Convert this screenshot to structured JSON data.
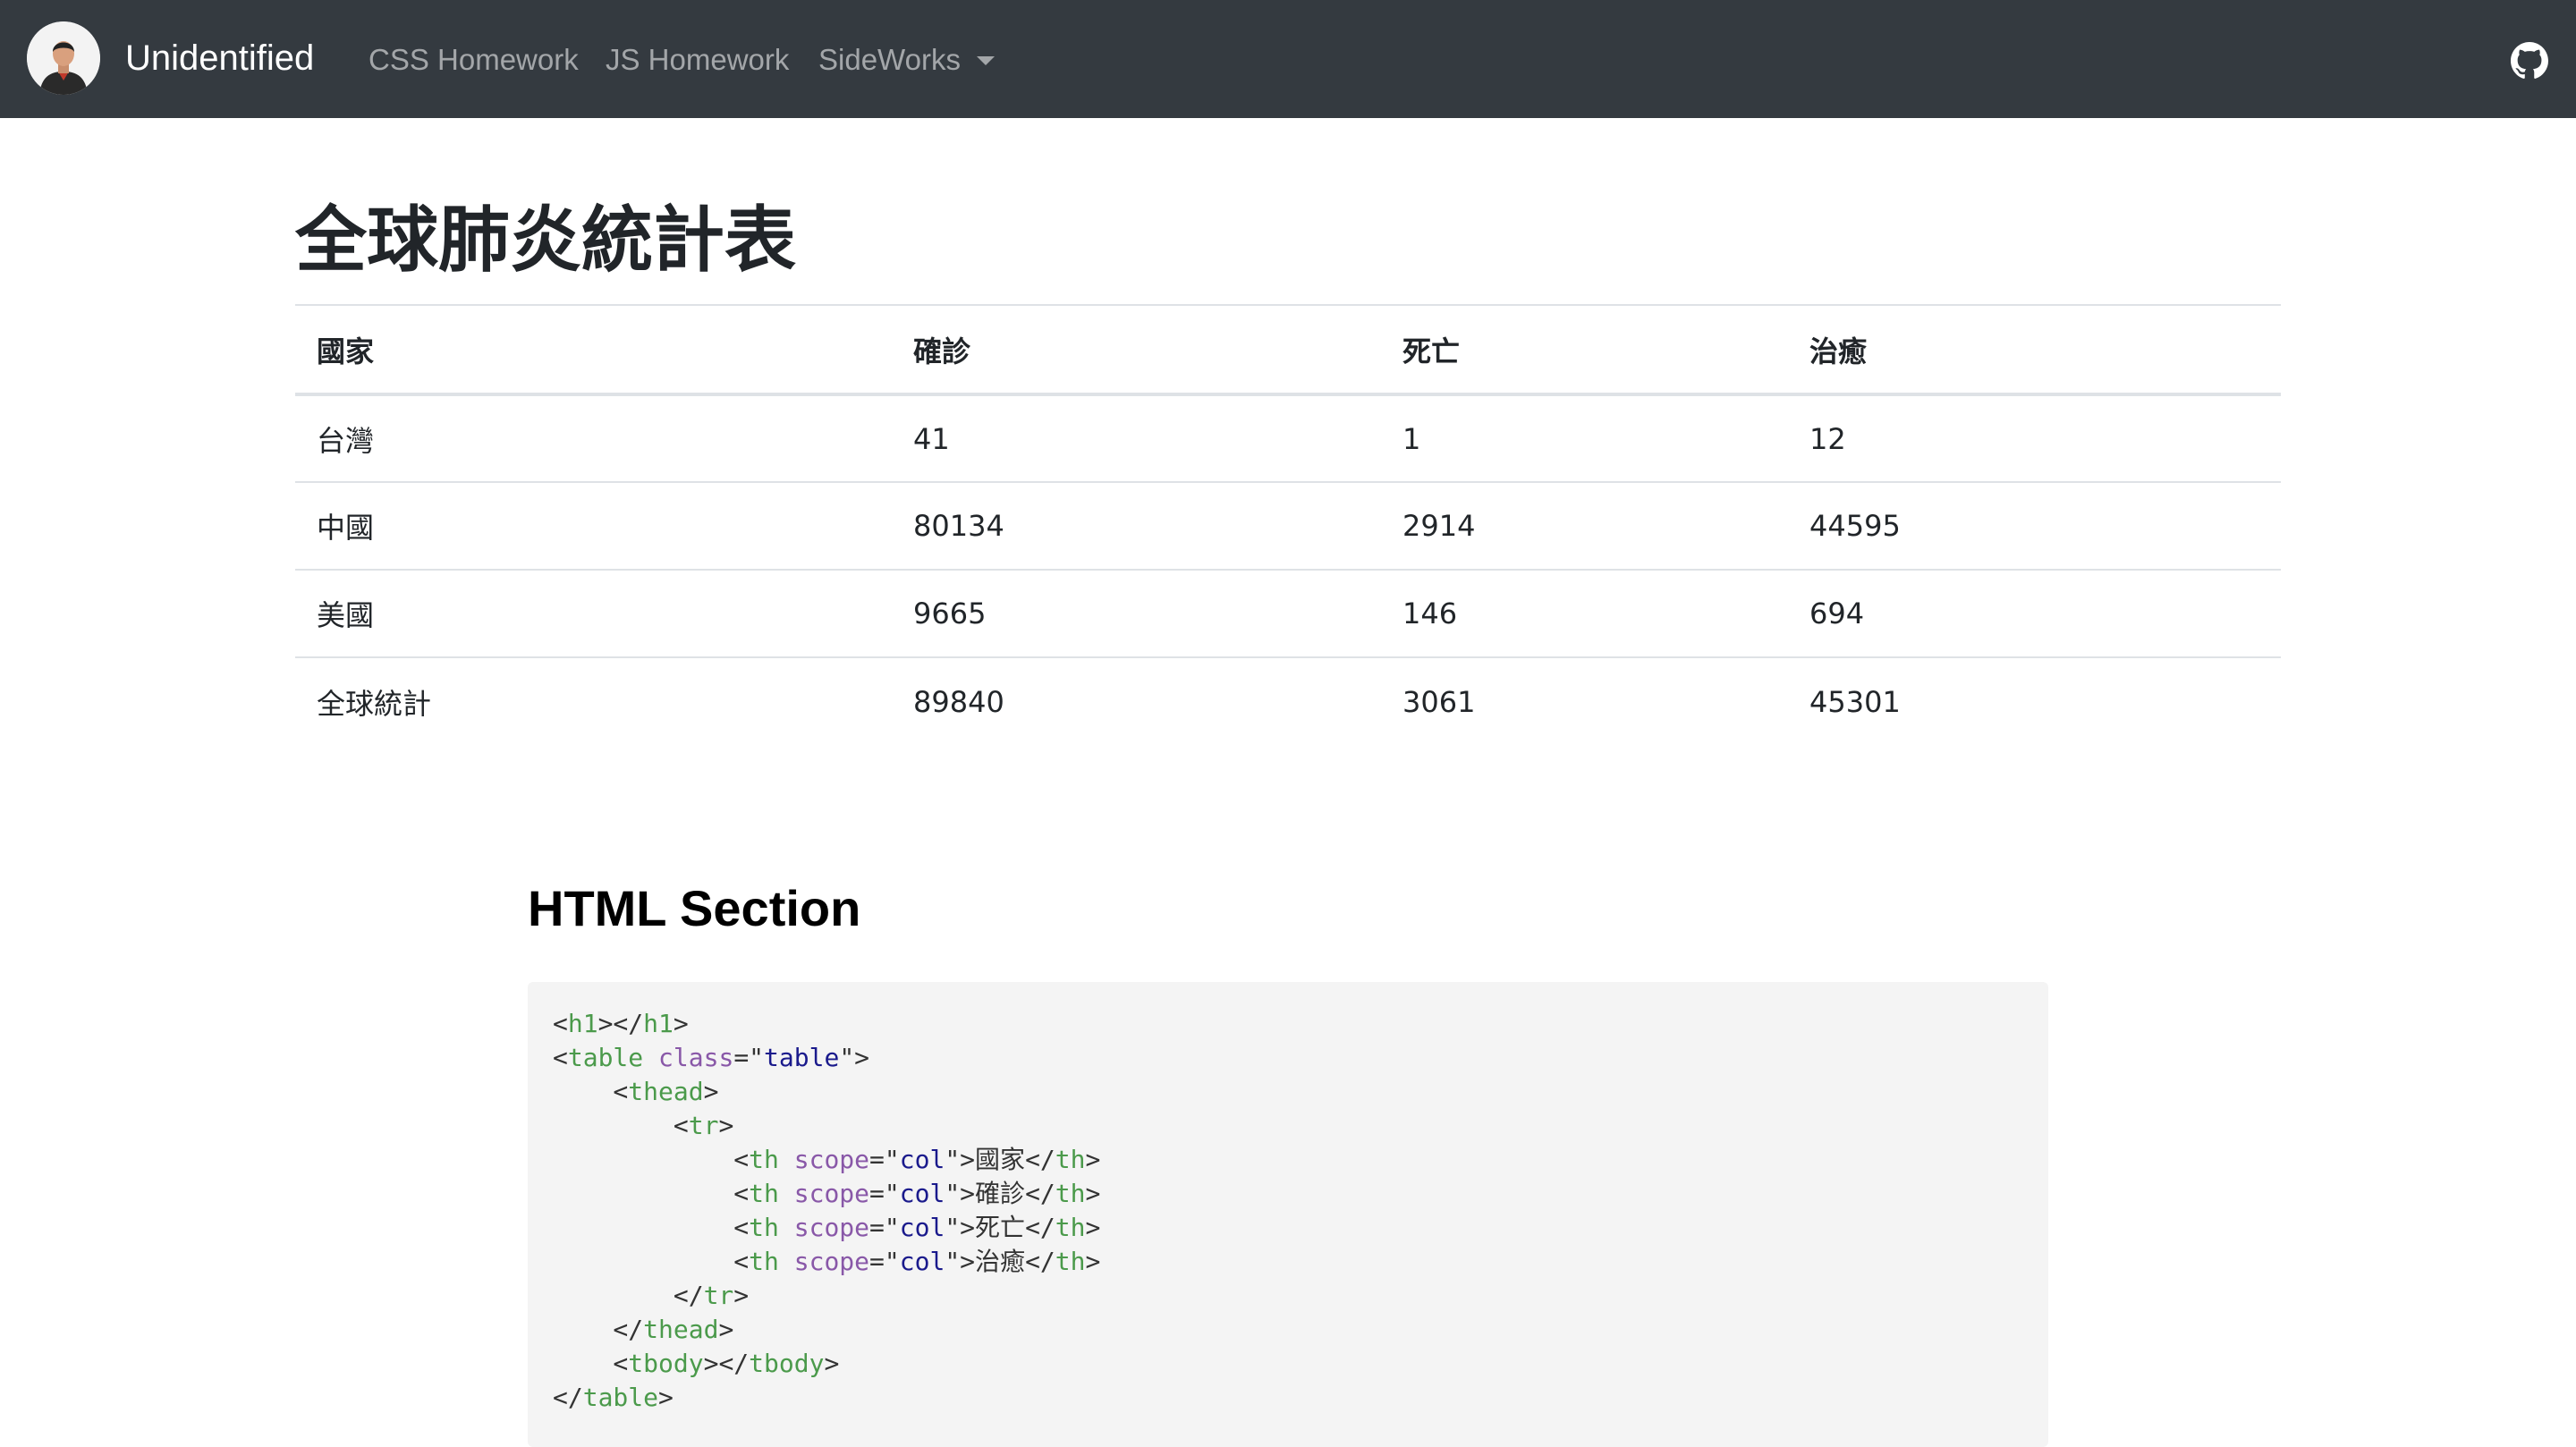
{
  "navbar": {
    "brand": "Unidentified",
    "links": [
      {
        "label": "CSS Homework"
      },
      {
        "label": "JS Homework"
      },
      {
        "label": "SideWorks"
      }
    ],
    "github_icon": "github-icon",
    "avatar_icon": "avatar"
  },
  "main": {
    "title": "全球肺炎統計表",
    "table": {
      "headers": [
        "國家",
        "確診",
        "死亡",
        "治癒"
      ],
      "rows": [
        [
          "台灣",
          "41",
          "1",
          "12"
        ],
        [
          "中國",
          "80134",
          "2914",
          "44595"
        ],
        [
          "美國",
          "9665",
          "146",
          "694"
        ],
        [
          "全球統計",
          "89840",
          "3061",
          "45301"
        ]
      ]
    }
  },
  "html_section": {
    "title": "HTML Section",
    "code": {
      "h1_open": "h1",
      "h1_close": "h1",
      "table": "table",
      "class_attr": "class",
      "class_val": "table",
      "thead": "thead",
      "tr": "tr",
      "th": "th",
      "scope_attr": "scope",
      "scope_val": "col",
      "th_texts": [
        "國家",
        "確診",
        "死亡",
        "治癒"
      ],
      "tbody": "tbody"
    }
  },
  "colors": {
    "navbar_bg": "#343a40",
    "code_bg": "#f4f4f4",
    "tag": "#4b9a4b",
    "attr": "#8958a8",
    "value": "#1a1a8c"
  }
}
